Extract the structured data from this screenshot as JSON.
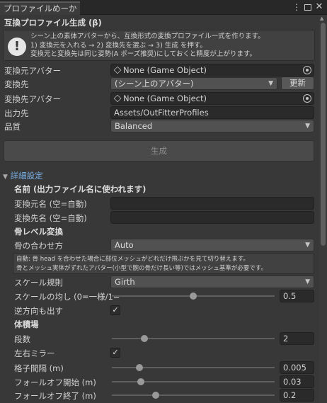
{
  "window": {
    "tab_title": "プロファイルめーかー",
    "menu_icon": "kebab-menu-icon",
    "maximize_icon": "maximize-icon",
    "close_icon": "close-icon"
  },
  "header": {
    "title": "互換プロファイル生成 (β)"
  },
  "info_box": {
    "line1": "シーン上の素体アバターから、互換形式の変換プロファイル一式を作ります。",
    "line2": "1) 変換元を入れる → 2) 変換先を選ぶ → 3) 生成 を押す。",
    "line3": "変換元と変換先は同じ姿勢(A ポーズ推奨)にしておくと精度が上がります。"
  },
  "source_avatar": {
    "label": "変換元アバター",
    "value": "None (Game Object)"
  },
  "destination": {
    "label": "変換先",
    "value": "(シーン上のアバター)",
    "refresh_label": "更新"
  },
  "destination_avatar": {
    "label": "変換先アバター",
    "value": "None (Game Object)"
  },
  "output": {
    "label": "出力先",
    "value": "Assets/OutFitterProfiles"
  },
  "quality": {
    "label": "品質",
    "value": "Balanced"
  },
  "generate_button": {
    "label": "生成"
  },
  "details": {
    "label": "詳細設定",
    "names_header": "名前 (出力ファイル名に使われます)",
    "source_name_label": "変換元名 (空=自動)",
    "source_name_value": "",
    "dest_name_label": "変換先名 (空=自動)",
    "dest_name_value": "",
    "bone_level_header": "骨レベル変換",
    "bone_match_label": "骨の合わせ方",
    "bone_match_value": "Auto",
    "bone_help_line1": "自動: 骨 head を合わせた場合に部位メッシュがどれだけ飛ぶかを見て切り替えます。",
    "bone_help_line2": "骨とメッシュ実体がずれたアバター(小型で腕の骨だけ長い等)ではメッシュ基準が必要です。",
    "scale_rule_label": "スケール規則",
    "scale_rule_value": "Girth",
    "scale_balance_label": "スケールの均し (0=一様/1=",
    "scale_balance_value": "0.5",
    "scale_balance_fraction": 0.5,
    "reverse_label": "逆方向も出す",
    "reverse_checked": true,
    "volume_header": "体積場",
    "stages_label": "段数",
    "stages_value": "2",
    "stages_fraction": 0.2,
    "mirror_label": "左右ミラー",
    "mirror_checked": true,
    "grid_label": "格子間隔 (m)",
    "grid_value": "0.005",
    "grid_fraction": 0.17,
    "falloff_start_label": "フォールオフ開始 (m)",
    "falloff_start_value": "0.03",
    "falloff_start_fraction": 0.18,
    "falloff_end_label": "フォールオフ終了 (m)",
    "falloff_end_value": "0.2",
    "falloff_end_fraction": 0.27
  }
}
